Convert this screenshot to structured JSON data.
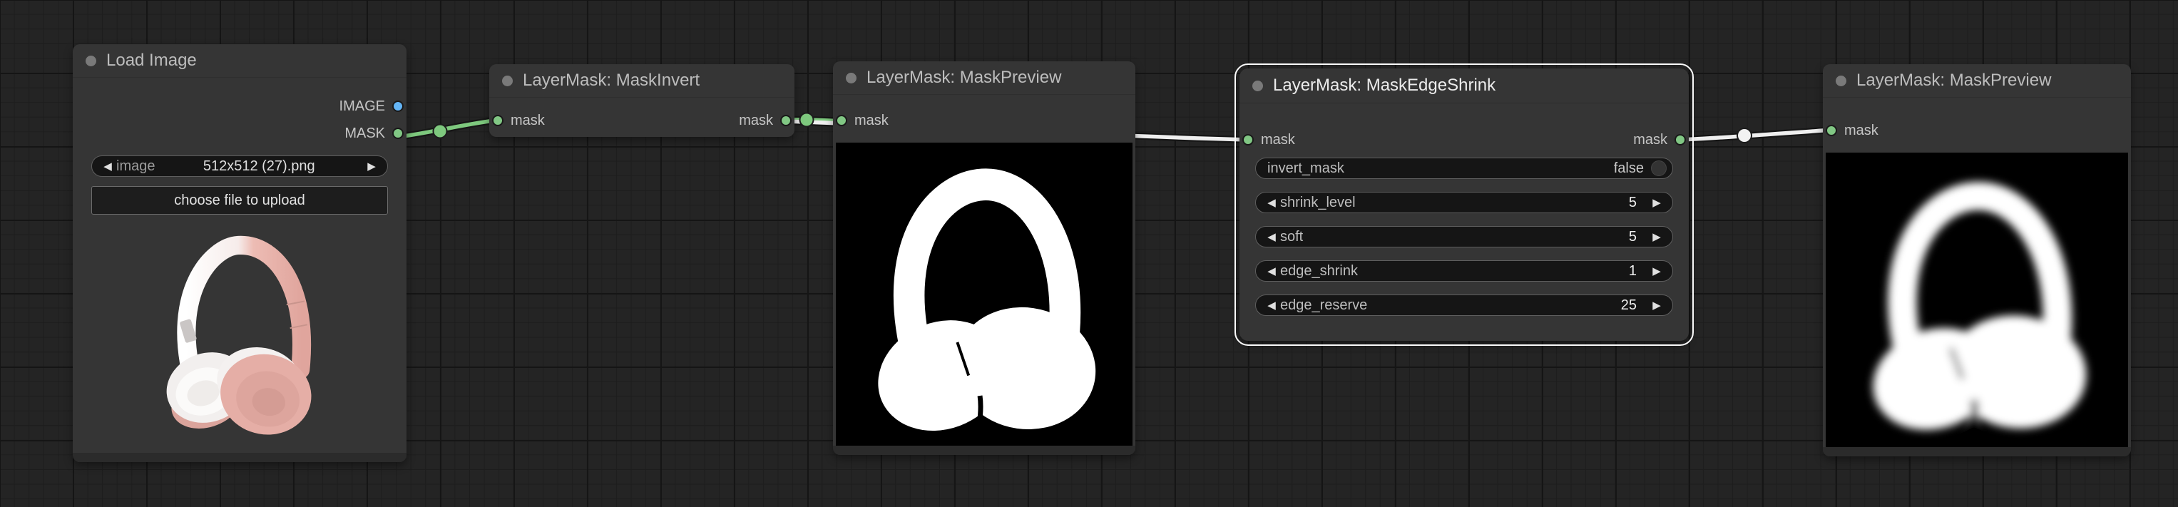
{
  "glyphs": {
    "arrow_left": "◀",
    "arrow_right": "▶"
  },
  "colors": {
    "canvas_bg": "#242424",
    "node_bg": "#353535",
    "image_port": "#64b5f6",
    "mask_port": "#81c784",
    "mask_link": "#7ec97e",
    "highlight_link": "#efefef",
    "selected_outline": "#fafafa"
  },
  "nodes": {
    "load_image": {
      "title": "Load Image",
      "outputs": [
        {
          "name": "IMAGE"
        },
        {
          "name": "MASK"
        }
      ],
      "widgets": {
        "image_combo": {
          "label": "image",
          "value": "512x512 (27).png"
        },
        "upload_button": {
          "label": "choose file to upload"
        }
      },
      "preview": "rose gold headphones photo"
    },
    "mask_invert": {
      "title": "LayerMask: MaskInvert",
      "input": "mask",
      "output": "mask"
    },
    "mask_preview_1": {
      "title": "LayerMask: MaskPreview",
      "input": "mask",
      "preview": "white headphones silhouette mask on black"
    },
    "mask_edge_shrink": {
      "title": "LayerMask: MaskEdgeShrink",
      "selected": true,
      "input": "mask",
      "output": "mask",
      "widgets": [
        {
          "type": "toggle",
          "label": "invert_mask",
          "value": "false"
        },
        {
          "type": "number",
          "label": "shrink_level",
          "value": "5"
        },
        {
          "type": "number",
          "label": "soft",
          "value": "5"
        },
        {
          "type": "number",
          "label": "edge_shrink",
          "value": "1"
        },
        {
          "type": "number",
          "label": "edge_reserve",
          "value": "25"
        }
      ]
    },
    "mask_preview_2": {
      "title": "LayerMask: MaskPreview",
      "input": "mask",
      "preview": "soft-edged white headphones mask on black"
    }
  },
  "links": [
    {
      "from": "Load Image.MASK",
      "to": "LayerMask: MaskInvert.mask",
      "color": "green"
    },
    {
      "from": "LayerMask: MaskInvert.mask",
      "to": "LayerMask: MaskPreview.mask",
      "color": "green"
    },
    {
      "from": "LayerMask: MaskInvert.mask",
      "to": "LayerMask: MaskEdgeShrink.mask",
      "color": "white"
    },
    {
      "from": "LayerMask: MaskEdgeShrink.mask",
      "to": "LayerMask: MaskPreview.mask",
      "color": "white"
    }
  ]
}
